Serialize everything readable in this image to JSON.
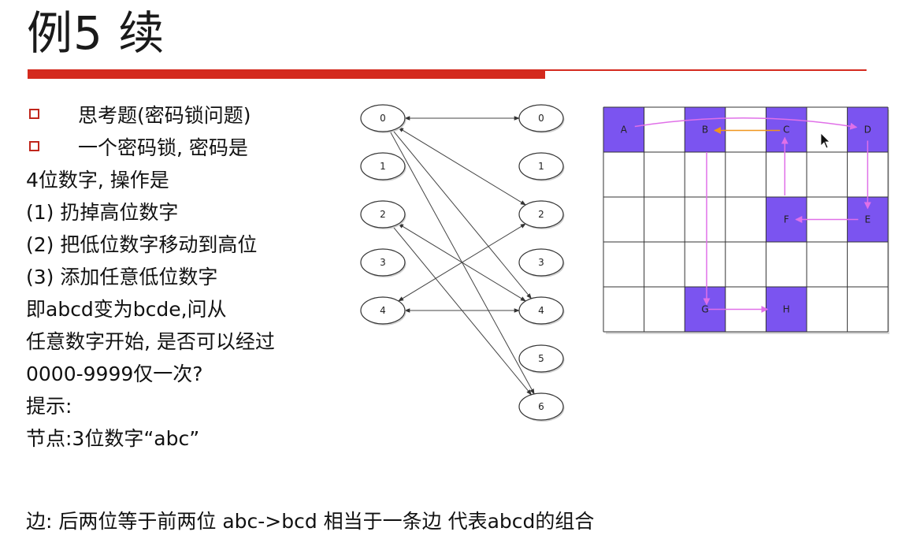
{
  "slide": {
    "title": "例5 续",
    "lines": [
      {
        "bullet": true,
        "text": "思考题(密码锁问题)"
      },
      {
        "bullet": true,
        "text": "一个密码锁, 密码是"
      },
      {
        "bullet": false,
        "text": "4位数字, 操作是"
      },
      {
        "bullet": false,
        "text": "(1) 扔掉高位数字"
      },
      {
        "bullet": false,
        "text": "(2) 把低位数字移动到高位"
      },
      {
        "bullet": false,
        "text": "(3) 添加任意低位数字"
      },
      {
        "bullet": false,
        "text": "即abcd变为bcde,问从"
      },
      {
        "bullet": false,
        "text": "任意数字开始, 是否可以经过"
      },
      {
        "bullet": false,
        "text": "0000-9999仅一次?"
      },
      {
        "bullet": false,
        "text": "提示:"
      },
      {
        "bullet": false,
        "text": "节点:3位数字“abc”"
      }
    ],
    "bottom_line": "边:  后两位等于前两位 abc->bcd 相当于一条边 代表abcd的组合"
  },
  "graph": {
    "left_nodes": [
      "0",
      "1",
      "2",
      "3",
      "4"
    ],
    "right_nodes": [
      "0",
      "1",
      "2",
      "3",
      "4",
      "5",
      "6"
    ],
    "edges": [
      {
        "from": 0,
        "to": 0,
        "bidirectional": true
      },
      {
        "from": 0,
        "to": 2,
        "bidirectional": true
      },
      {
        "from": 0,
        "to": 4,
        "bidirectional": false
      },
      {
        "from": 0,
        "to": 6,
        "bidirectional": false
      },
      {
        "from": 2,
        "to": 4,
        "bidirectional": true
      },
      {
        "from": 2,
        "to": 6,
        "bidirectional": false
      },
      {
        "from": 4,
        "to": 2,
        "bidirectional": true
      },
      {
        "from": 4,
        "to": 4,
        "bidirectional": true
      }
    ]
  },
  "grid": {
    "rows": 5,
    "cols": 7,
    "highlight_color": "#7b54f0",
    "arrow_color": "#e070e8",
    "orange_arrow_color": "#f0961e",
    "cells": [
      {
        "label": "A",
        "row": 0,
        "col": 0
      },
      {
        "label": "B",
        "row": 0,
        "col": 2
      },
      {
        "label": "C",
        "row": 0,
        "col": 4
      },
      {
        "label": "D",
        "row": 0,
        "col": 6
      },
      {
        "label": "E",
        "row": 2,
        "col": 6
      },
      {
        "label": "F",
        "row": 2,
        "col": 4
      },
      {
        "label": "G",
        "row": 4,
        "col": 2
      },
      {
        "label": "H",
        "row": 4,
        "col": 4
      }
    ]
  }
}
